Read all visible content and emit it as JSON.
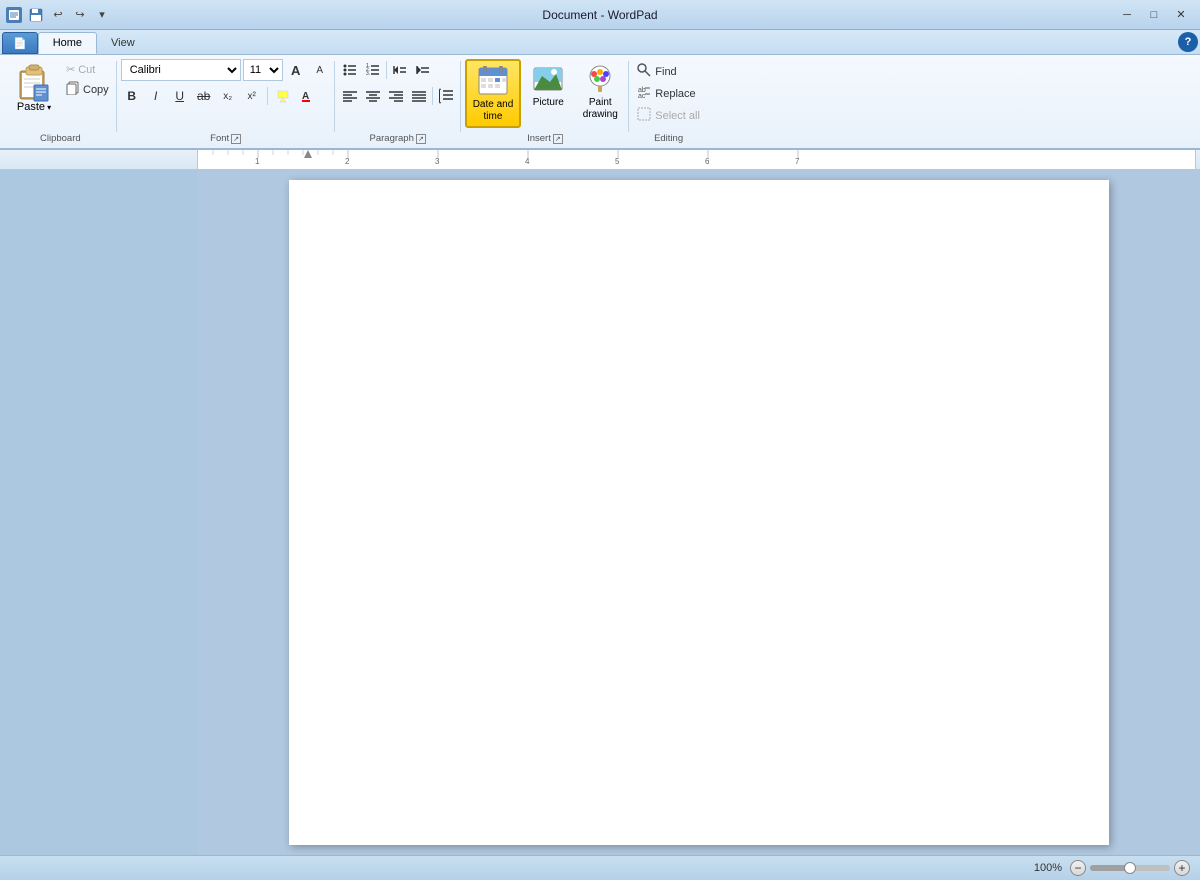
{
  "window": {
    "title": "Document - WordPad",
    "minimize_label": "─",
    "maximize_label": "□",
    "close_label": "✕"
  },
  "quick_access": {
    "save": "💾",
    "undo": "↩",
    "redo": "↪",
    "dropdown": "▾"
  },
  "tabs": {
    "home": "Home",
    "view": "View"
  },
  "clipboard": {
    "paste": "Paste",
    "cut": "Cut",
    "copy": "Copy",
    "label": "Clipboard"
  },
  "font": {
    "name": "Calibri",
    "size": "11",
    "grow": "A",
    "shrink": "A",
    "bold": "B",
    "italic": "I",
    "underline": "U",
    "strikethrough": "ab",
    "subscript": "x₂",
    "superscript": "x²",
    "highlight": "▲",
    "color": "A",
    "label": "Font",
    "placeholder_name": "Calibri",
    "placeholder_size": "11"
  },
  "paragraph": {
    "bullets": "☰",
    "decrease": "◁",
    "increase": "▷",
    "align_left": "≡",
    "align_center": "≡",
    "align_right": "≡",
    "justify": "≡",
    "line_spacing": "↕",
    "label": "Paragraph"
  },
  "insert": {
    "date_time": "Date and\ntime",
    "picture": "Picture",
    "paint_drawing": "Paint\ndrawing",
    "label": "Insert"
  },
  "editing": {
    "find": "Find",
    "replace": "Replace",
    "select_all": "Select all",
    "label": "Editing"
  },
  "status": {
    "zoom_percent": "100%"
  }
}
